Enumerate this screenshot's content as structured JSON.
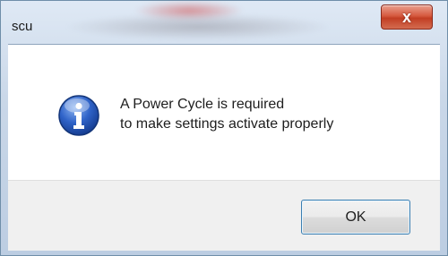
{
  "window": {
    "title": "scu"
  },
  "close_button": {
    "label": "x"
  },
  "message": {
    "line1": "A Power Cycle is required",
    "line2": "to make settings activate properly"
  },
  "buttons": {
    "ok": "OK"
  },
  "icon": {
    "type": "info-icon",
    "color": "#2f63c8"
  }
}
